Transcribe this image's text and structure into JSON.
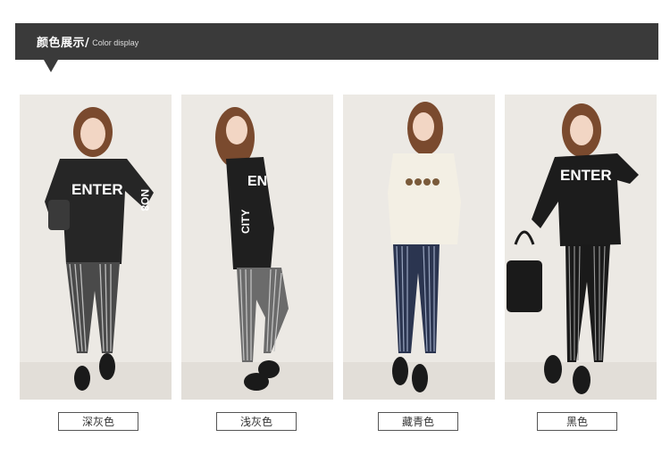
{
  "header": {
    "title_cn": "颜色展示/",
    "title_en": "Color display"
  },
  "variants": [
    {
      "label": "深灰色",
      "shirt_text": "ENTER",
      "sleeve_text": "NO8",
      "shirt": "#262626",
      "leggings": "#4a4a4a",
      "stripe": "#bdbdbd"
    },
    {
      "label": "浅灰色",
      "shirt_text": "EN",
      "sleeve_text": "CITY",
      "shirt": "#1f1f1f",
      "leggings": "#6b6b6b",
      "stripe": "#c8c8c8"
    },
    {
      "label": "藏青色",
      "shirt_text": "",
      "sleeve_text": "",
      "shirt": "#f3efe4",
      "leggings": "#2b3550",
      "stripe": "#9aa6c0"
    },
    {
      "label": "黑色",
      "shirt_text": "ENTER",
      "sleeve_text": "",
      "shirt": "#1c1c1c",
      "leggings": "#1a1a1a",
      "stripe": "#9a9a9a"
    }
  ],
  "colors": {
    "header_bg": "#3a3a3a",
    "photo_bg": "#ece9e4"
  }
}
